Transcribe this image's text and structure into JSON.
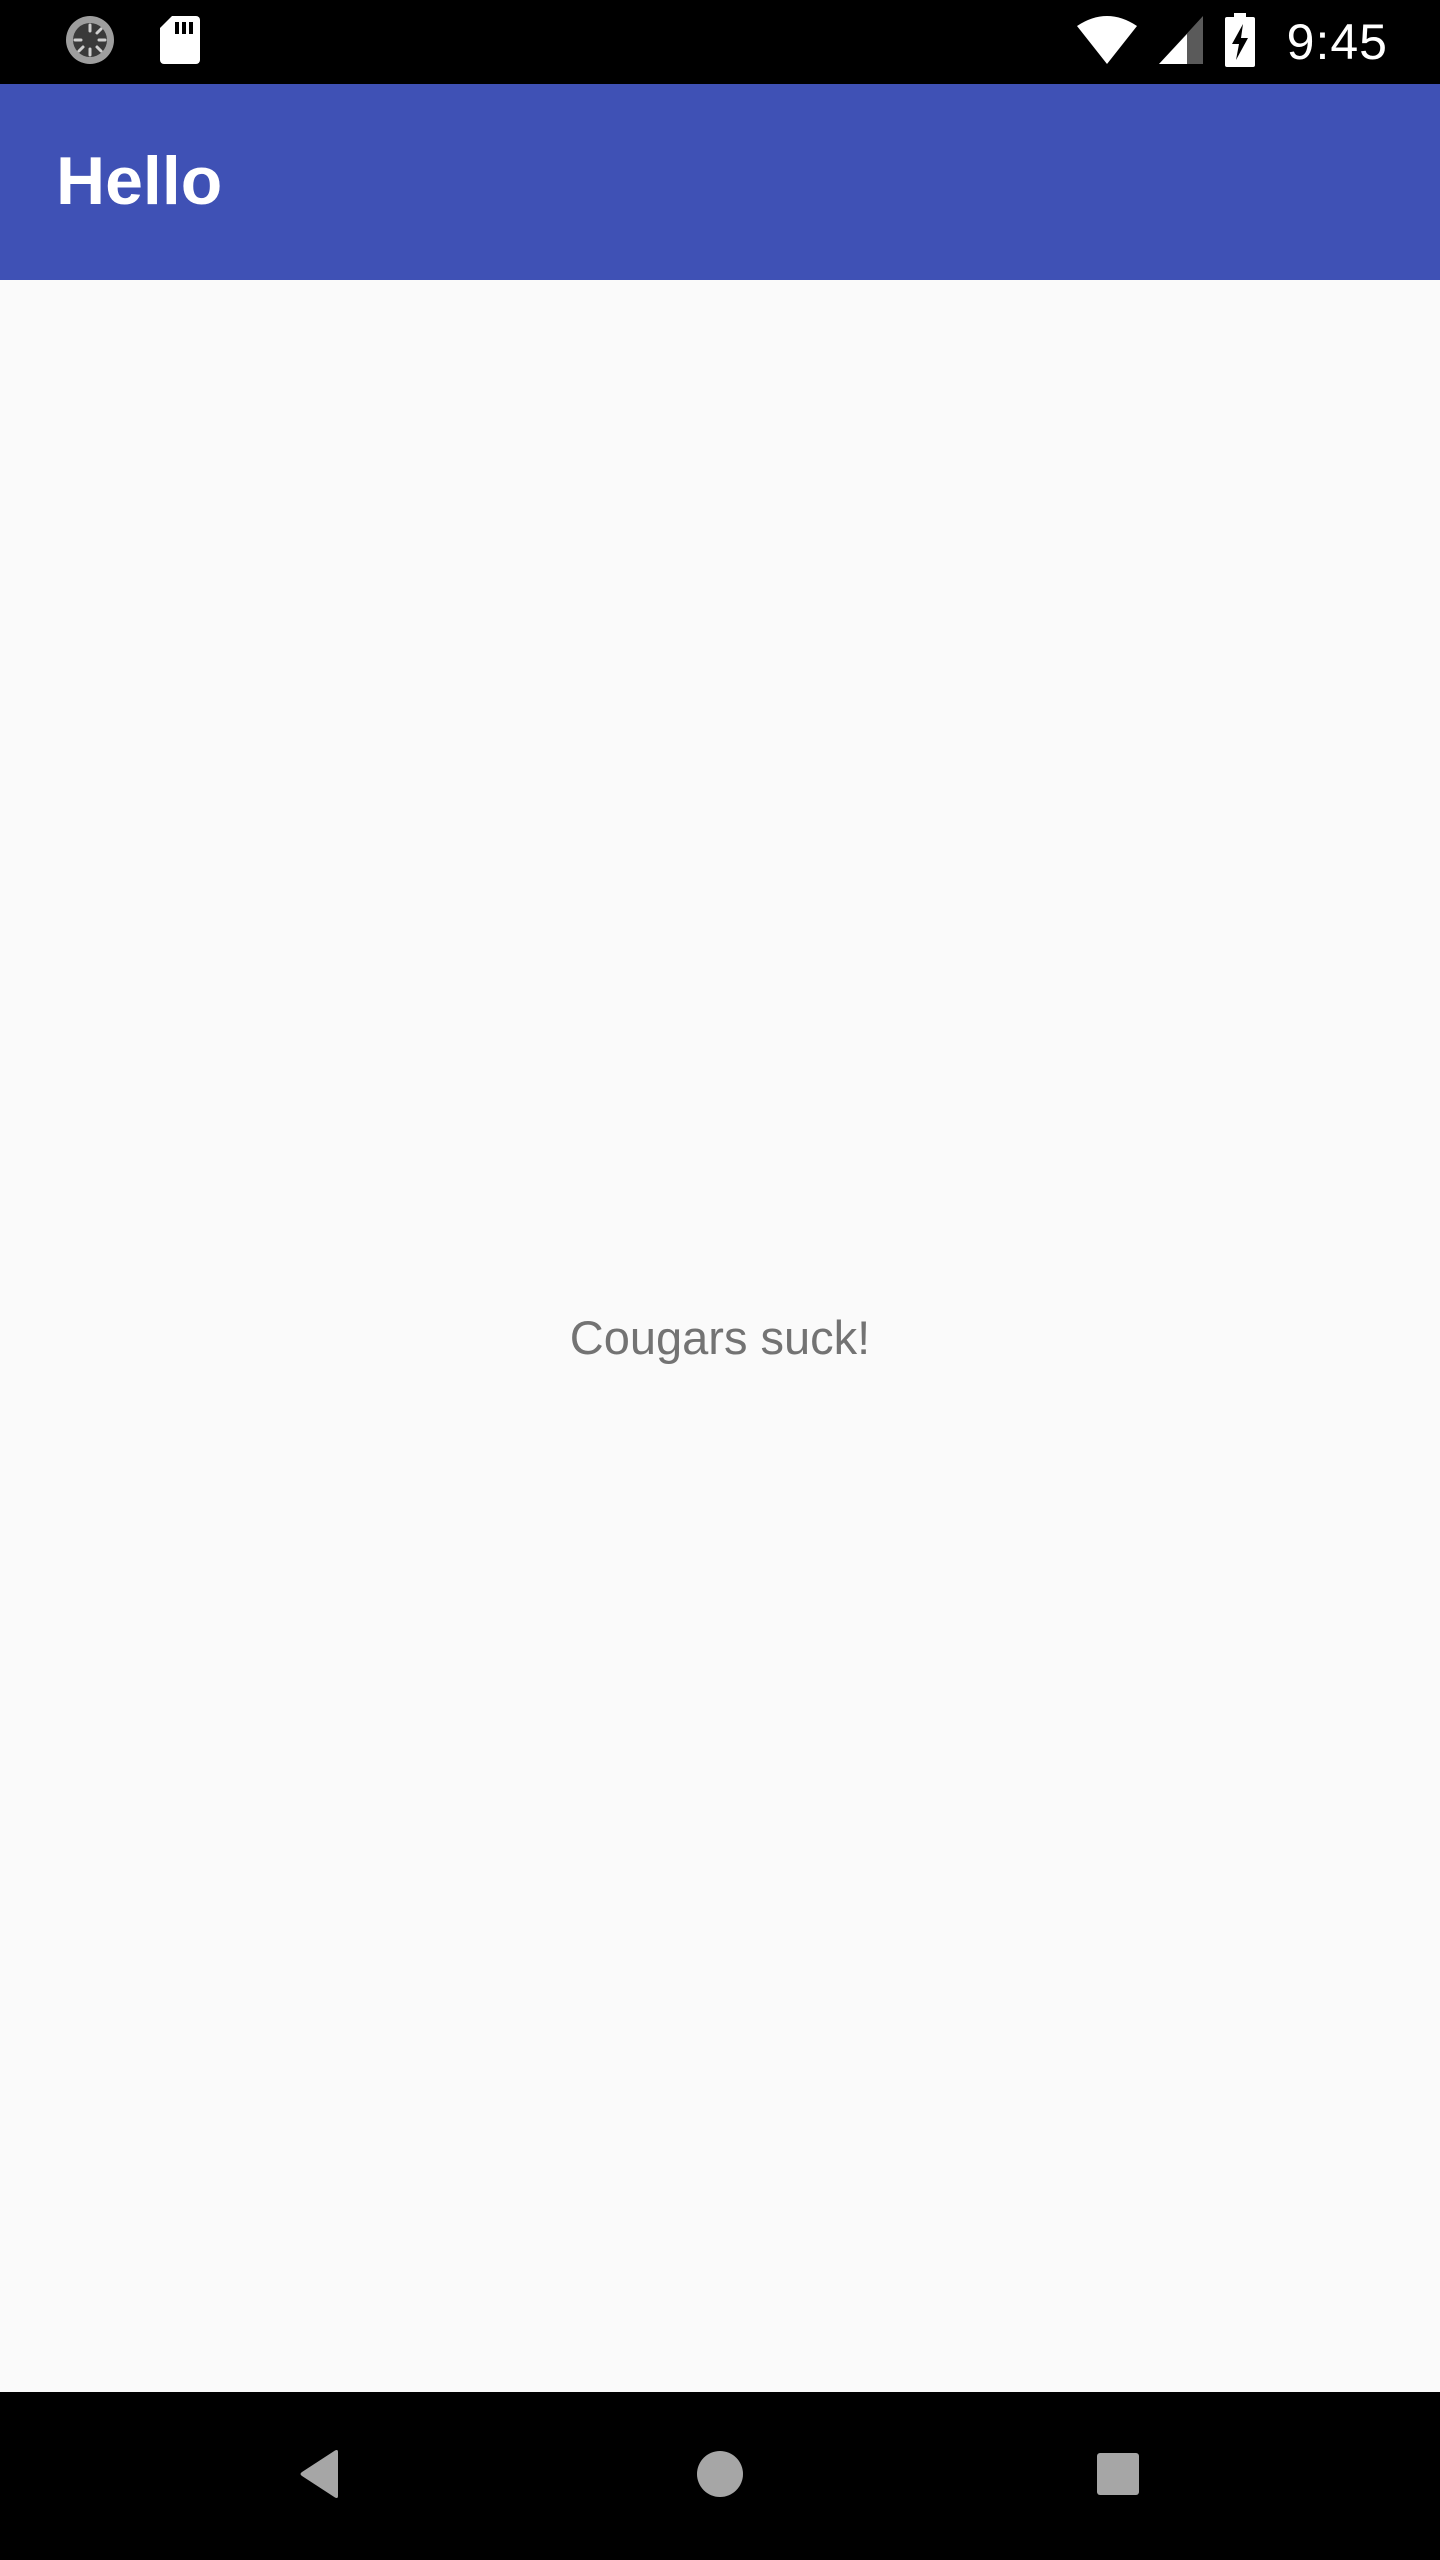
{
  "status_bar": {
    "time": "9:45",
    "icons": [
      "sync-icon",
      "sd-card-icon",
      "wifi-icon",
      "signal-icon",
      "battery-charging-icon"
    ]
  },
  "app_bar": {
    "title": "Hello",
    "color": "#3f51b5"
  },
  "content": {
    "message": "Cougars suck!"
  },
  "nav_bar": {
    "buttons": [
      "back-icon",
      "home-icon",
      "recents-icon"
    ]
  }
}
